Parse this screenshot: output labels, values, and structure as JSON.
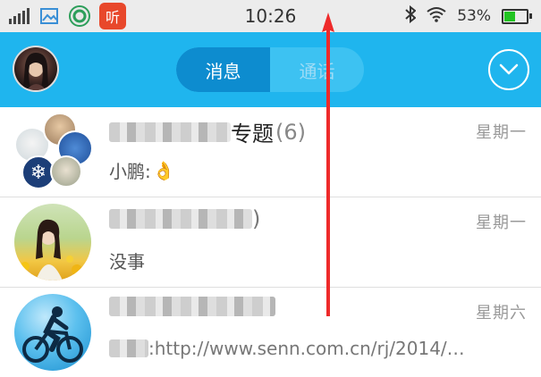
{
  "status_bar": {
    "time": "10:26",
    "battery_text": "53%",
    "battery_level": 0.53,
    "icons": [
      "signal-icon",
      "gallery-icon",
      "app-green-icon",
      "app-listen-icon",
      "bluetooth-icon",
      "wifi-icon",
      "battery-icon"
    ],
    "listen_app_label": "听"
  },
  "header": {
    "tabs": [
      {
        "label": "消息",
        "active": true
      },
      {
        "label": "通话",
        "active": false
      }
    ],
    "accent_color": "#1fb5ee"
  },
  "conversations": [
    {
      "name_suffix": "专题",
      "count": "(6)",
      "time": "星期一",
      "preview": "小鹏:",
      "preview_emoji": "👌"
    },
    {
      "name_suffix": ")",
      "time": "星期一",
      "preview": "没事"
    },
    {
      "time": "星期六",
      "preview": ":http://www.senn.com.cn/rj/2014/…"
    }
  ]
}
